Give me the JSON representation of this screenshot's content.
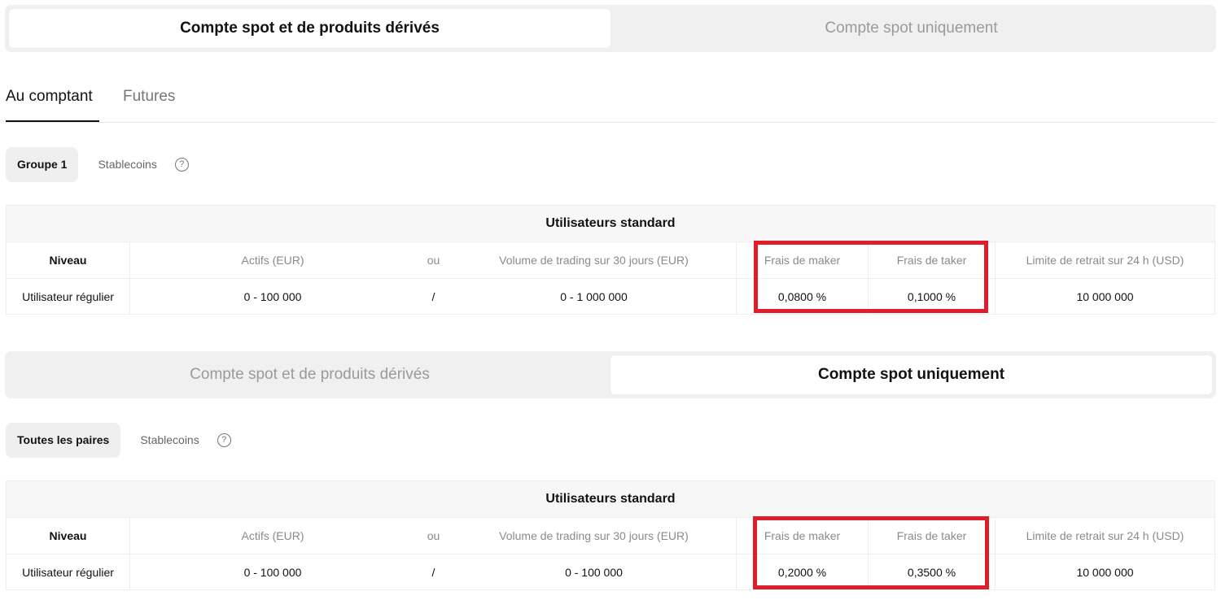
{
  "account_toggle_1": {
    "options": [
      "Compte spot et de produits dérivés",
      "Compte spot uniquement"
    ],
    "active_index": 0
  },
  "main_tabs": [
    "Au comptant",
    "Futures"
  ],
  "section1": {
    "pills": [
      "Groupe 1",
      "Stablecoins"
    ],
    "table": {
      "title": "Utilisateurs standard",
      "headers": {
        "level": "Niveau",
        "assets": "Actifs (EUR)",
        "or": "ou",
        "volume": "Volume de trading sur 30 jours (EUR)",
        "maker": "Frais de maker",
        "taker": "Frais de taker",
        "limit": "Limite de retrait sur 24 h (USD)"
      },
      "row": {
        "level": "Utilisateur régulier",
        "assets": "0 - 100 000",
        "or": "/",
        "volume": "0 - 1 000 000",
        "maker": "0,0800 %",
        "taker": "0,1000 %",
        "limit": "10 000 000"
      }
    }
  },
  "account_toggle_2": {
    "options": [
      "Compte spot et de produits dérivés",
      "Compte spot uniquement"
    ],
    "active_index": 1
  },
  "section2": {
    "pills": [
      "Toutes les paires",
      "Stablecoins"
    ],
    "table": {
      "title": "Utilisateurs standard",
      "headers": {
        "level": "Niveau",
        "assets": "Actifs (EUR)",
        "or": "ou",
        "volume": "Volume de trading sur 30 jours (EUR)",
        "maker": "Frais de maker",
        "taker": "Frais de taker",
        "limit": "Limite de retrait sur 24 h (USD)"
      },
      "row": {
        "level": "Utilisateur régulier",
        "assets": "0 - 100 000",
        "or": "/",
        "volume": "0 - 100 000",
        "maker": "0,2000 %",
        "taker": "0,3500 %",
        "limit": "10 000 000"
      }
    }
  },
  "help_icon_glyph": "?",
  "colors": {
    "highlight": "#e01e2b",
    "active_text": "#121212",
    "inactive_text": "#9a9a9a"
  },
  "icons": [
    "help-icon"
  ]
}
